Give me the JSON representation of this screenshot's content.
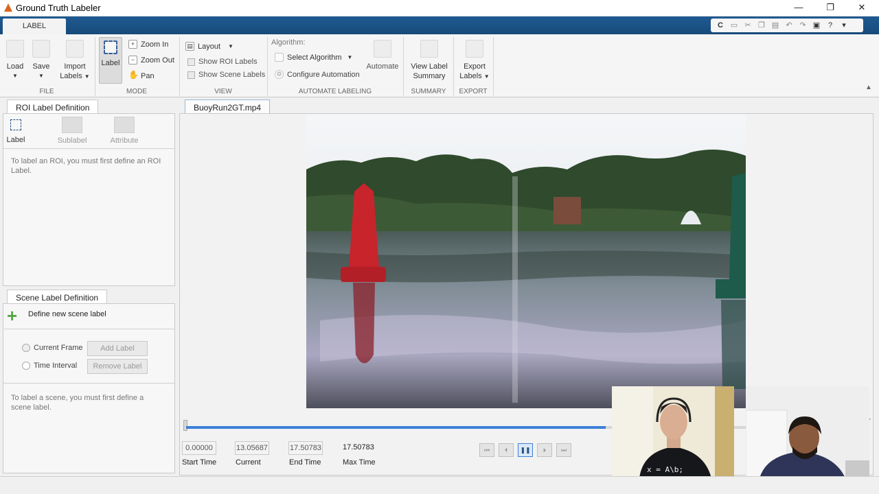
{
  "window": {
    "title": "Ground Truth Labeler",
    "minimize": "—",
    "restore": "❐",
    "close": "✕"
  },
  "ribbon": {
    "tab": "LABEL",
    "file": {
      "load": "Load",
      "save": "Save",
      "import_line1": "Import",
      "import_line2": "Labels",
      "group": "FILE"
    },
    "mode": {
      "label": "Label",
      "zoom_in": "Zoom In",
      "zoom_out": "Zoom Out",
      "pan": "Pan",
      "group": "MODE"
    },
    "view": {
      "layout": "Layout",
      "show_roi": "Show ROI Labels",
      "show_scene": "Show Scene Labels",
      "group": "VIEW"
    },
    "automate": {
      "algorithm_label": "Algorithm:",
      "select_algorithm": "Select Algorithm",
      "configure": "Configure Automation",
      "automate": "Automate",
      "group": "AUTOMATE LABELING"
    },
    "summary": {
      "line1": "View Label",
      "line2": "Summary",
      "group": "SUMMARY"
    },
    "export": {
      "line1": "Export",
      "line2": "Labels",
      "group": "EXPORT"
    }
  },
  "quick_access": {
    "search": "C",
    "icons": [
      "save-icon",
      "cut-icon",
      "copy-icon",
      "paste-icon",
      "undo-icon",
      "redo-icon",
      "layout-icon",
      "help-icon"
    ]
  },
  "roi_panel": {
    "tab": "ROI Label Definition",
    "label_btn": "Label",
    "sublabel_btn": "Sublabel",
    "attribute_btn": "Attribute",
    "hint": "To label an ROI, you must first define an ROI Label."
  },
  "scene_panel": {
    "tab": "Scene Label Definition",
    "define": "Define new scene label",
    "current_frame": "Current Frame",
    "time_interval": "Time Interval",
    "add_label": "Add Label",
    "remove_label": "Remove Label",
    "hint": "To label a scene, you must first define a scene label."
  },
  "document": {
    "tab": "BuoyRun2GT.mp4"
  },
  "playback": {
    "start_time": "0.00000",
    "current": "13.05687",
    "end_time": "17.50783",
    "max_time": "17.50783",
    "start_label": "Start Time",
    "current_label": "Current",
    "end_label": "End Time",
    "max_label": "Max Time",
    "progress": 0.75
  },
  "webcam": {
    "shirt_text": "x = A\\b;"
  }
}
